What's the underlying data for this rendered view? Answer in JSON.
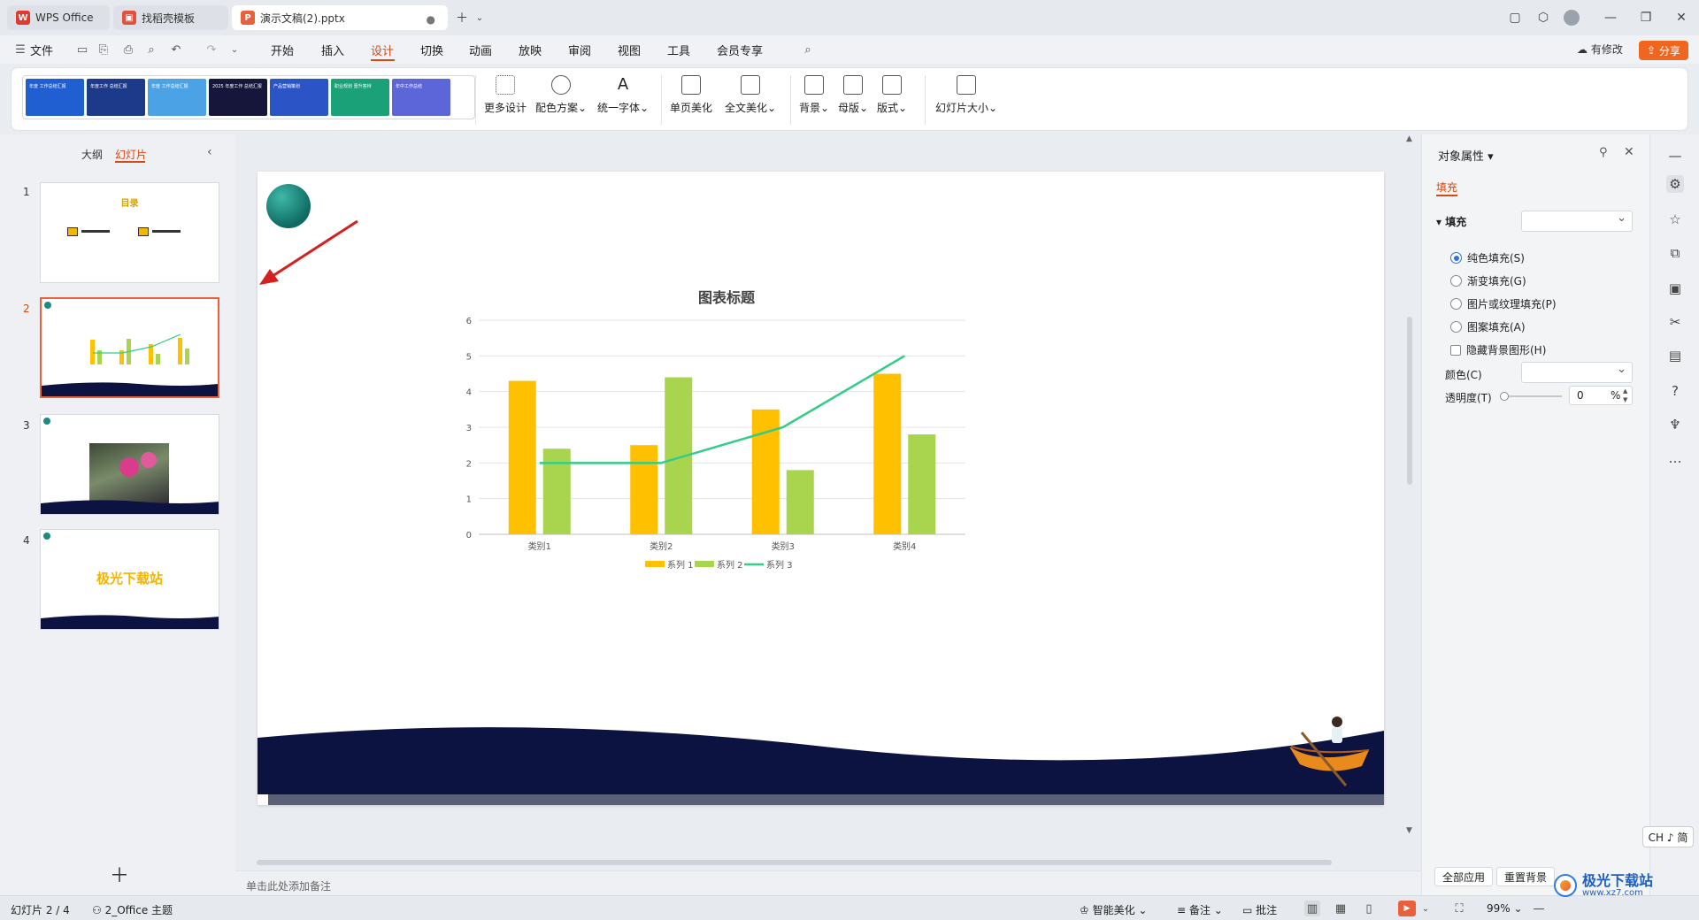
{
  "tabs": [
    {
      "label": "WPS Office",
      "active": false
    },
    {
      "label": "找稻壳模板",
      "active": false
    },
    {
      "label": "演示文稿(2).pptx",
      "active": true
    }
  ],
  "menu": {
    "file": "文件",
    "items": [
      "开始",
      "插入",
      "设计",
      "切换",
      "动画",
      "放映",
      "审阅",
      "视图",
      "工具",
      "会员专享"
    ],
    "active": "设计",
    "modified": "有修改",
    "share": "分享"
  },
  "ribbon": {
    "templates": [
      {
        "text": "年度 工作总结汇报",
        "color": "#1f5fd1"
      },
      {
        "text": "年度工作 总结汇报",
        "color": "#1d3a8a"
      },
      {
        "text": "年度 工作总结汇报",
        "color": "#4ba3e6"
      },
      {
        "text": "2025 年度工作 总结汇报",
        "color": "#16163a"
      },
      {
        "text": "产品营销策划",
        "color": "#2b55c6"
      },
      {
        "text": "职业规划 晋升答辩",
        "color": "#1aa178"
      },
      {
        "text": "年中工作总结",
        "color": "#5d66d8"
      }
    ],
    "buttons": {
      "more_design": "更多设计",
      "color_scheme": "配色方案",
      "unify_font": "统一字体",
      "single_beautify": "单页美化",
      "full_beautify": "全文美化",
      "background": "背景",
      "master": "母版",
      "layout": "版式",
      "slide_size": "幻灯片大小"
    }
  },
  "left_panel": {
    "tab_outline": "大纲",
    "tab_slides": "幻灯片",
    "slides": [
      {
        "num": "1",
        "title": "目录"
      },
      {
        "num": "2",
        "title": ""
      },
      {
        "num": "3",
        "title": ""
      },
      {
        "num": "4",
        "title": "极光下载站"
      }
    ],
    "selected": 2
  },
  "notes_placeholder": "单击此处添加备注",
  "chart_data": {
    "type": "bar",
    "title": "图表标题",
    "categories": [
      "类别1",
      "类别2",
      "类别3",
      "类别4"
    ],
    "series": [
      {
        "name": "系列 1",
        "kind": "bar",
        "color": "#ffc000",
        "values": [
          4.3,
          2.5,
          3.5,
          4.5
        ]
      },
      {
        "name": "系列 2",
        "kind": "bar",
        "color": "#a9d44d",
        "values": [
          2.4,
          4.4,
          1.8,
          2.8
        ]
      },
      {
        "name": "系列 3",
        "kind": "line",
        "color": "#33cc88",
        "values": [
          2,
          2,
          3,
          5
        ]
      }
    ],
    "ylim": [
      0,
      6
    ],
    "yticks": [
      "0",
      "1",
      "2",
      "3",
      "4",
      "5",
      "6"
    ],
    "grid": true,
    "legend": "bottom"
  },
  "right_panel": {
    "title": "对象属性",
    "tab_fill": "填充",
    "section_fill": "填充",
    "options": [
      {
        "label": "纯色填充(S)",
        "checked": true
      },
      {
        "label": "渐变填充(G)",
        "checked": false
      },
      {
        "label": "图片或纹理填充(P)",
        "checked": false
      },
      {
        "label": "图案填充(A)",
        "checked": false
      }
    ],
    "hide_bg": "隐藏背景图形(H)",
    "color_label": "颜色(C)",
    "transparency_label": "透明度(T)",
    "transparency_value": "0",
    "transparency_unit": "%",
    "apply_all": "全部应用",
    "reset_bg": "重置背景"
  },
  "ime": "CH ♪ 简",
  "status": {
    "slide_counter": "幻灯片 2 / 4",
    "theme": "2_Office 主题",
    "smart_beautify": "智能美化",
    "notes": "备注",
    "comments": "批注",
    "zoom": "99%"
  },
  "watermark": {
    "text": "极光下载站",
    "url": "www.xz7.com"
  },
  "colors": {
    "accent": "#d9480f",
    "share": "#f0661e",
    "navy": "#0d1340"
  }
}
